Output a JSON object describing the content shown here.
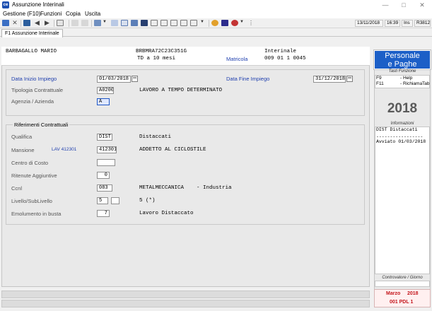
{
  "window": {
    "title": "Assunzione Interinali",
    "icon": "app-logo-icon"
  },
  "menu": [
    "Gestione (F10)",
    "Funzioni",
    "Copia",
    "Uscita"
  ],
  "toolbar": {
    "status": {
      "date": "13/11/2018",
      "time": "16:39",
      "mode": "Ins",
      "release": "R3812"
    }
  },
  "tabs": [
    {
      "label": "F1 Assunzione Interinale"
    }
  ],
  "employee": {
    "name": "BARBAGALLO MARIO",
    "tax_code": "BRBMRA72C23C351G",
    "contract_short": "TD a 10 mesi",
    "type": "Interinale",
    "matricola_label": "Matricola",
    "matricola": "009 01 1 0045"
  },
  "form": {
    "data_inizio": {
      "label": "Data Inizio Impiego",
      "value": "01/03/2018"
    },
    "data_fine": {
      "label": "Data Fine Impiego",
      "value": "31/12/2018"
    },
    "tipologia": {
      "label": "Tipologia Contrattuale",
      "code": "A0200",
      "desc": "LAVORO A TEMPO DETERMINATO"
    },
    "agenzia": {
      "label": "Agenzia / Azienda",
      "value": "A"
    }
  },
  "riferimenti": {
    "title": "Riferimenti Contrattuali",
    "qualifica": {
      "label": "Qualifica",
      "code": "DIST",
      "desc": "Distaccati"
    },
    "mansione": {
      "label": "Mansione",
      "note": "LAV 412301",
      "code": "412301",
      "desc": "ADDETTO AL CICLOSTILE"
    },
    "centro_costo": {
      "label": "Centro di Costo",
      "value": ""
    },
    "ritenute": {
      "label": "Ritenute Aggiuntive",
      "value": "0"
    },
    "ccnl": {
      "label": "Ccnl",
      "code": "083",
      "desc": "METALMECCANICA    - Industria"
    },
    "livello": {
      "label": "Livello/SubLivello",
      "value": "5",
      "sub": "",
      "desc": "5 (*)"
    },
    "emolumento": {
      "label": "Emolumento in busta",
      "value": "7",
      "desc": "Lavoro Distaccato"
    }
  },
  "side": {
    "brand": [
      "Personale",
      "e Paghe"
    ],
    "tasti_title": "Tasti Funzione",
    "fkeys": [
      {
        "key": "F9",
        "label": "- Help"
      },
      {
        "key": "F11",
        "label": "- RichiamaTab"
      }
    ],
    "year": "2018",
    "info_title": "Informazioni",
    "info_lines": [
      "DIST  Distaccati",
      "-----------------",
      "Avviato 01/03/2018"
    ],
    "controvalore_title": "Controvalore / Giorno",
    "period_month": "Marzo",
    "period_year": "2018",
    "period_code": "001 PDL 1"
  },
  "colors": {
    "brand_blue": "#1c5fc7",
    "label_blue": "#1f3fae",
    "period_red": "#c4161c"
  }
}
